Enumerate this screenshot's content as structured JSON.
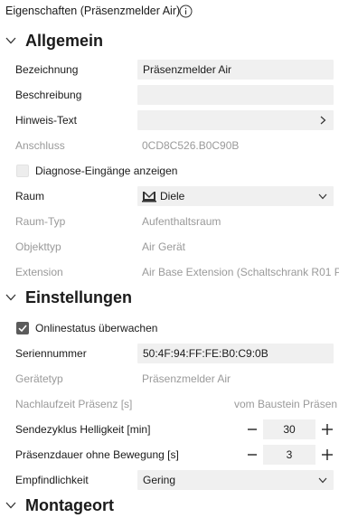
{
  "header": {
    "title": "Eigenschaften (Präsenzmelder Air)",
    "info_icon": "info-circle-icon"
  },
  "sections": {
    "allgemein": "Allgemein",
    "einstellungen": "Einstellungen",
    "montageort": "Montageort"
  },
  "allgemein": {
    "bezeichnung": {
      "label": "Bezeichnung",
      "value": "Präsenzmelder Air"
    },
    "beschreibung": {
      "label": "Beschreibung",
      "value": ""
    },
    "hinweis": {
      "label": "Hinweis-Text",
      "value": ""
    },
    "anschluss": {
      "label": "Anschluss",
      "value": "0CD8C526.B0C90B"
    },
    "diagnose": {
      "label": "Diagnose-Eingänge anzeigen",
      "checked": false
    },
    "raum": {
      "label": "Raum",
      "value": "Diele",
      "icon": "room-icon"
    },
    "raumtyp": {
      "label": "Raum-Typ",
      "value": "Aufenthaltsraum"
    },
    "objekttyp": {
      "label": "Objekttyp",
      "value": "Air Gerät"
    },
    "extension": {
      "label": "Extension",
      "value": "Air Base Extension (Schaltschrank R01 P0"
    }
  },
  "einstellungen": {
    "onlinestatus": {
      "label": "Onlinestatus überwachen",
      "checked": true
    },
    "seriennummer": {
      "label": "Seriennummer",
      "value": "50:4F:94:FF:FE:B0:C9:0B"
    },
    "geraetetyp": {
      "label": "Gerätetyp",
      "value": "Präsenzmelder Air"
    },
    "nachlaufzeit": {
      "label": "Nachlaufzeit Präsenz [s]",
      "value": "vom Baustein Präsen"
    },
    "sendezyklus": {
      "label": "Sendezyklus Helligkeit [min]",
      "value": "30"
    },
    "praesenzdauer": {
      "label": "Präsenzdauer ohne Bewegung [s]",
      "value": "3"
    },
    "empfindlichkeit": {
      "label": "Empfindlichkeit",
      "value": "Gering"
    }
  },
  "stepper": {
    "minus": "−",
    "plus": "+"
  }
}
